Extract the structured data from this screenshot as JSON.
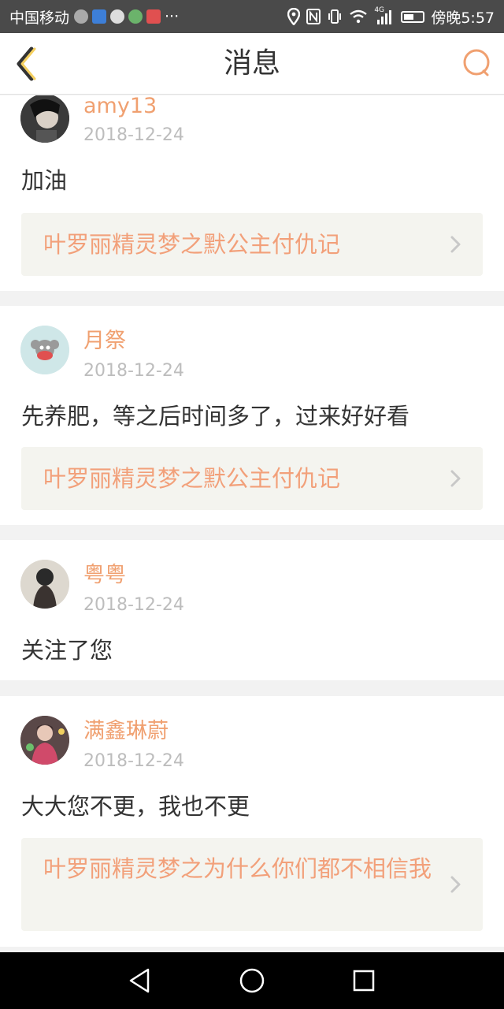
{
  "status_bar": {
    "carrier": "中国移动",
    "extra_icons": "···",
    "network_label": "4G",
    "time": "傍晚5:57"
  },
  "header": {
    "title": "消息"
  },
  "messages": [
    {
      "username": "amy13",
      "date": "2018-12-24",
      "content": "加油",
      "link": "叶罗丽精灵梦之默公主付仇记"
    },
    {
      "username": "月祭",
      "date": "2018-12-24",
      "content": "先养肥，等之后时间多了，过来好好看",
      "link": "叶罗丽精灵梦之默公主付仇记"
    },
    {
      "username": "粤粤",
      "date": "2018-12-24",
      "content": "关注了您"
    },
    {
      "username": "满鑫琳蔚",
      "date": "2018-12-24",
      "content": "大大您不更，我也不更",
      "link": "叶罗丽精灵梦之为什么你们都不相信我"
    }
  ],
  "colors": {
    "accent": "#f0a070",
    "status_bar": "#4a4a4a",
    "link_box_bg": "#f4f4ef"
  }
}
